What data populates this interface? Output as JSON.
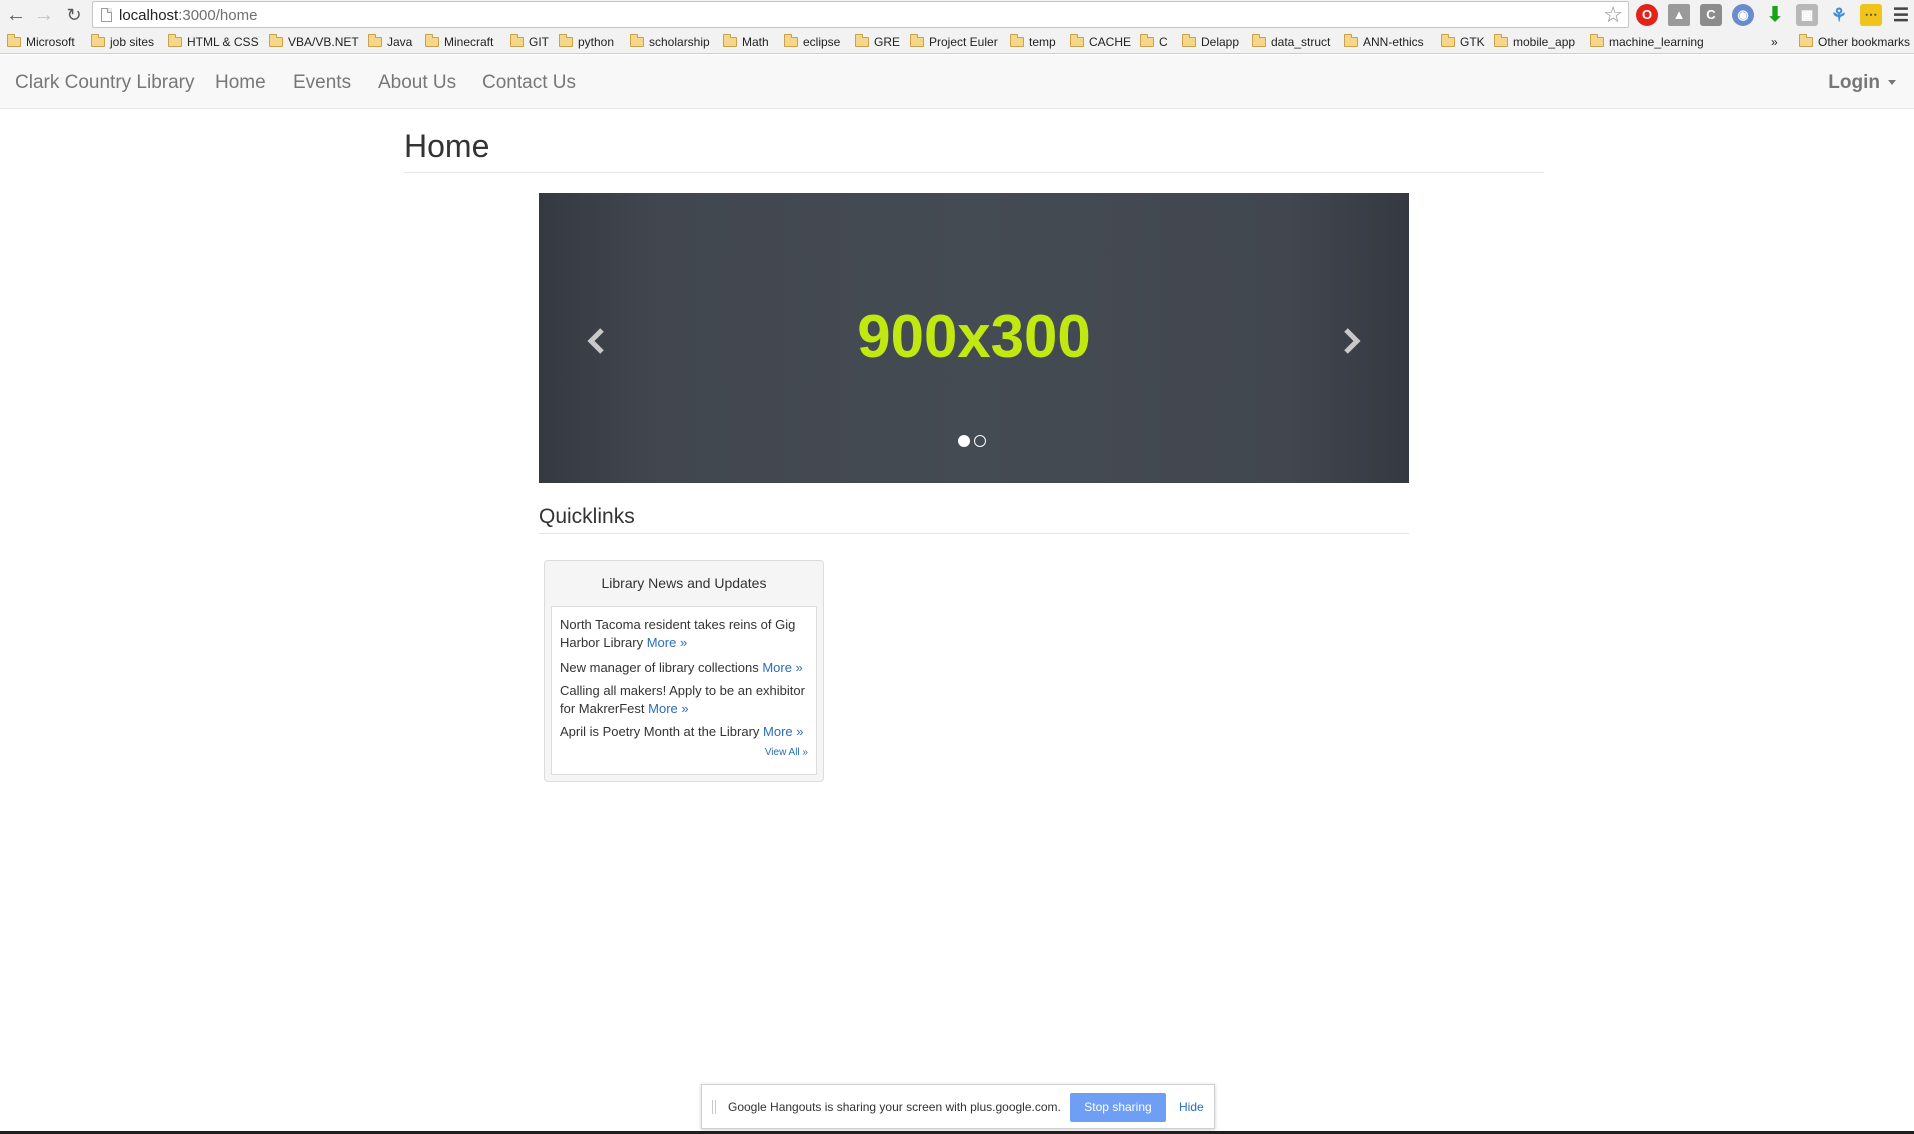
{
  "browser": {
    "url_host": "localhost",
    "url_path": ":3000/home",
    "bookmarks": [
      "Microsoft",
      "job sites",
      "HTML & CSS",
      "VBA/VB.NET",
      "Java",
      "Minecraft",
      "GIT",
      "python",
      "scholarship",
      "Math",
      "eclipse",
      "GRE",
      "Project Euler",
      "temp",
      "CACHE",
      "C",
      "Delapp",
      "data_struct",
      "ANN-ethics",
      "GTK",
      "mobile_app",
      "machine_learning"
    ],
    "bookmarks_overflow": "»",
    "other_bookmarks": "Other bookmarks"
  },
  "navbar": {
    "brand": "Clark Country Library",
    "links": [
      "Home",
      "Events",
      "About Us",
      "Contact Us"
    ],
    "login": "Login"
  },
  "page": {
    "title": "Home"
  },
  "carousel": {
    "placeholder_text": "900x300",
    "slide_count": 2,
    "active_slide": 1,
    "text_color": "#c2e812"
  },
  "quicklinks": {
    "title": "Quicklinks",
    "panel_title": "Library News and Updates",
    "items": [
      {
        "text": "North Tacoma resident takes reins of Gig Harbor Library",
        "more": "More »"
      },
      {
        "text": "New manager of library collections",
        "more": "More »"
      },
      {
        "text": "Calling all makers! Apply to be an exhibitor for MakrerFest",
        "more": "More »"
      },
      {
        "text": "April is Poetry Month at the Library",
        "more": "More »"
      }
    ],
    "view_all": "View All »"
  },
  "share_banner": {
    "message": "Google Hangouts is sharing your screen with plus.google.com.",
    "stop_label": "Stop sharing",
    "hide_label": "Hide"
  }
}
